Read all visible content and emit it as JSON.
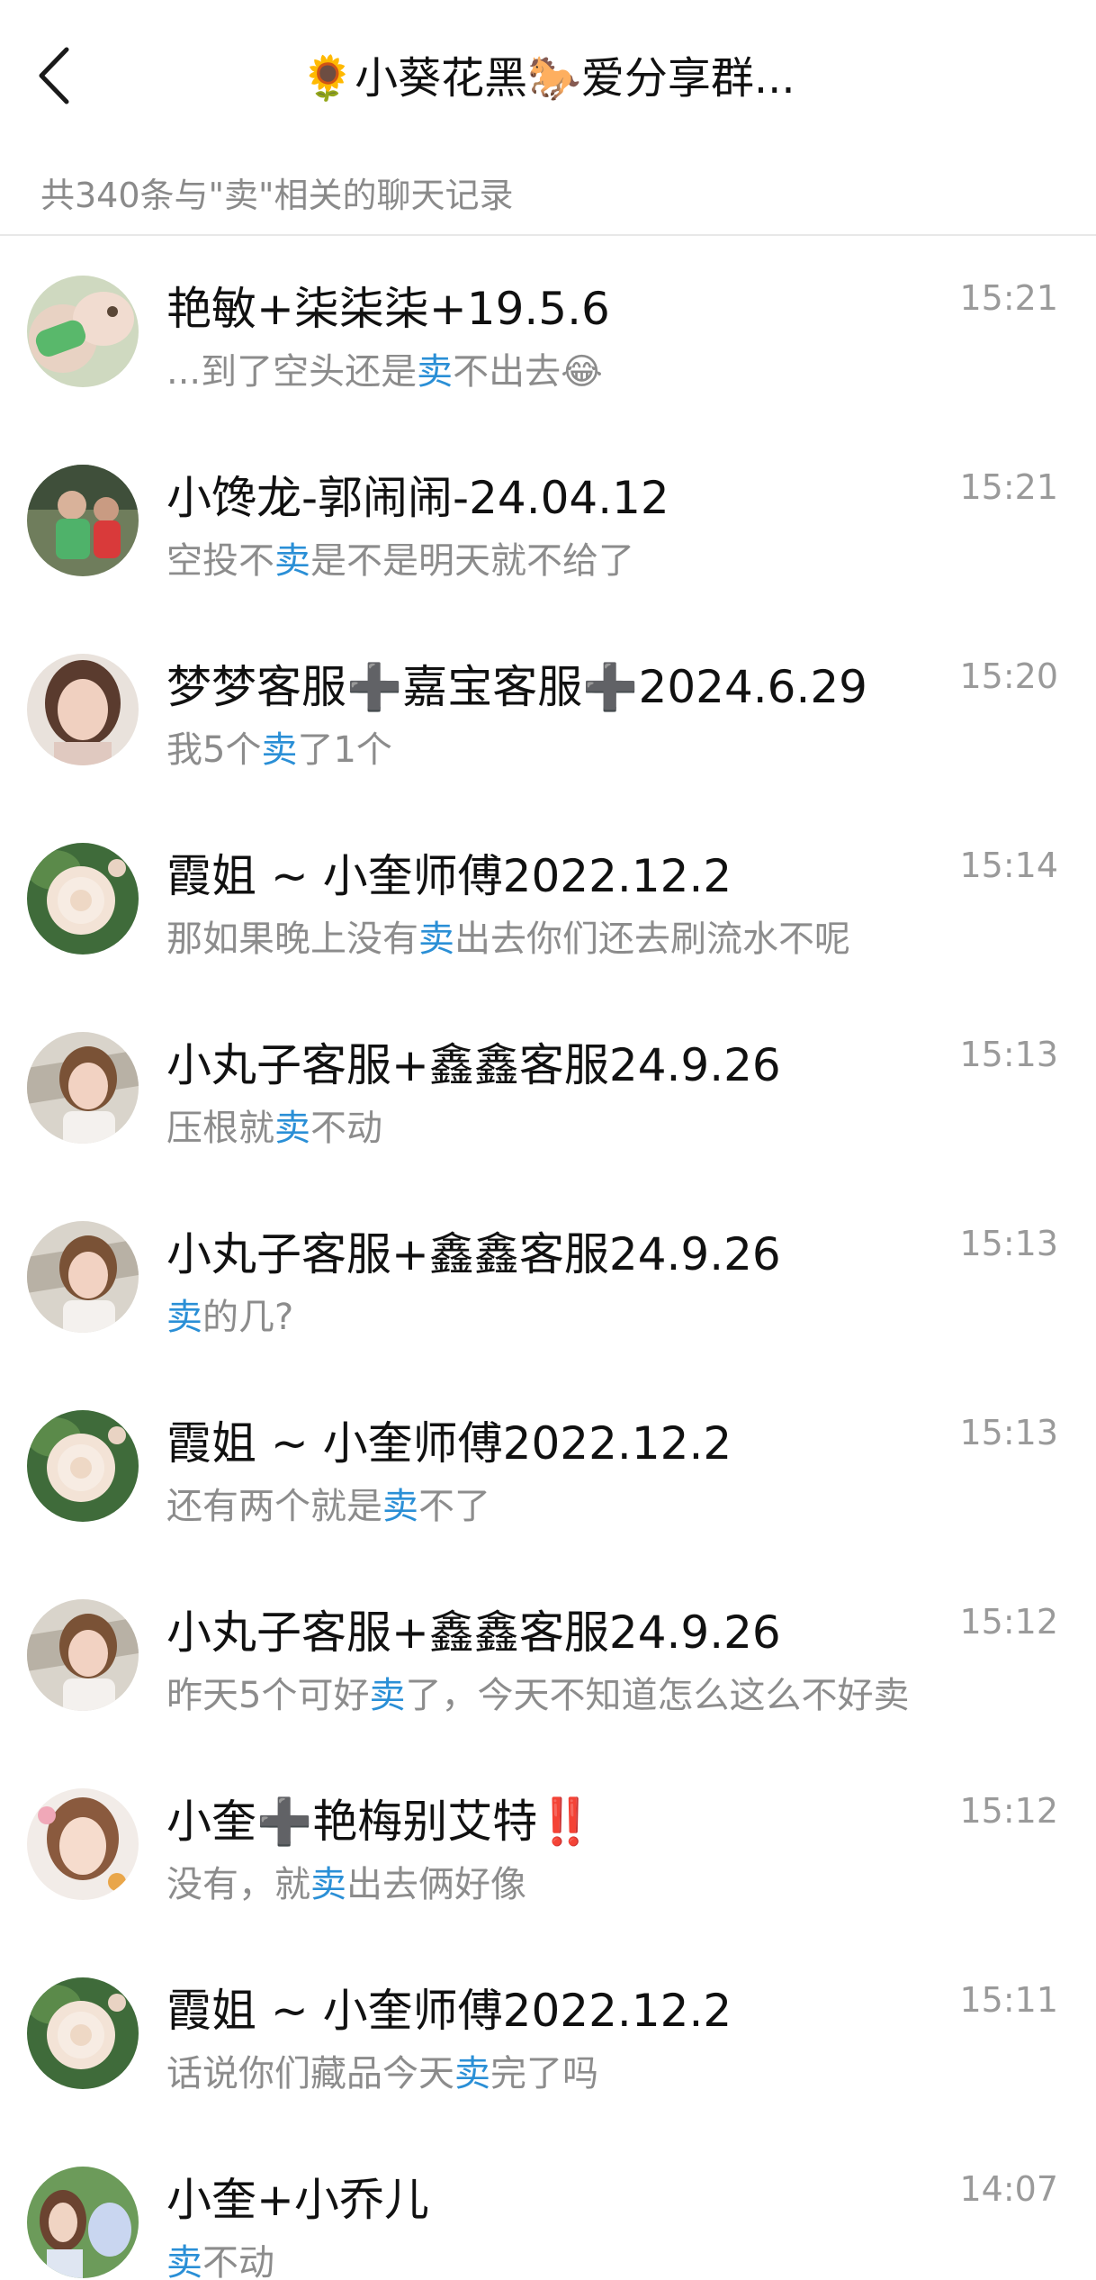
{
  "header": {
    "title": "🌻小葵花黑🐎爱分享群...",
    "back_icon": "chevron-left-icon"
  },
  "summary": "共340条与\"卖\"相关的聊天记录",
  "keyword_color": "#2a8fd6",
  "results": [
    {
      "name": "艳敏+柒柒柒+19.5.6",
      "time": "15:21",
      "pre": "...到了空头还是",
      "kw": "卖",
      "post": "不出去😂",
      "avatar": "avatar-photo-child-bottle"
    },
    {
      "name": "小馋龙-郭闹闹-24.04.12",
      "time": "15:21",
      "pre": "空投不",
      "kw": "卖",
      "post": "是不是明天就不给了",
      "avatar": "avatar-photo-kids"
    },
    {
      "name": "梦梦客服➕嘉宝客服➕2024.6.29",
      "time": "15:20",
      "pre": "我5个",
      "kw": "卖",
      "post": "了1个",
      "avatar": "avatar-photo-woman"
    },
    {
      "name": "霞姐 ~ 小奎师傅2022.12.2",
      "time": "15:14",
      "pre": "那如果晚上没有",
      "kw": "卖",
      "post": "出去你们还去刷流水不呢",
      "avatar": "avatar-rose"
    },
    {
      "name": "小丸子客服+鑫鑫客服24.9.26",
      "time": "15:13",
      "pre": "压根就",
      "kw": "卖",
      "post": "不动",
      "avatar": "avatar-photo-woman-outdoor"
    },
    {
      "name": "小丸子客服+鑫鑫客服24.9.26",
      "time": "15:13",
      "pre": "",
      "kw": "卖",
      "post": "的几?",
      "avatar": "avatar-photo-woman-outdoor"
    },
    {
      "name": "霞姐 ~ 小奎师傅2022.12.2",
      "time": "15:13",
      "pre": "还有两个就是",
      "kw": "卖",
      "post": "不了",
      "avatar": "avatar-rose"
    },
    {
      "name": "小丸子客服+鑫鑫客服24.9.26",
      "time": "15:12",
      "pre": "昨天5个可好",
      "kw": "卖",
      "post": "了，今天不知道怎么这么不好卖",
      "avatar": "avatar-photo-woman-outdoor"
    },
    {
      "name": "小奎➕艳梅别艾特‼️",
      "time": "15:12",
      "pre": "没有，就",
      "kw": "卖",
      "post": "出去俩好像",
      "avatar": "avatar-photo-woman-light"
    },
    {
      "name": "霞姐 ~ 小奎师傅2022.12.2",
      "time": "15:11",
      "pre": "话说你们藏品今天",
      "kw": "卖",
      "post": "完了吗",
      "avatar": "avatar-rose"
    },
    {
      "name": "小奎+小乔儿",
      "time": "14:07",
      "pre": "",
      "kw": "卖",
      "post": "不动",
      "avatar": "avatar-photo-woman-flowers"
    }
  ]
}
